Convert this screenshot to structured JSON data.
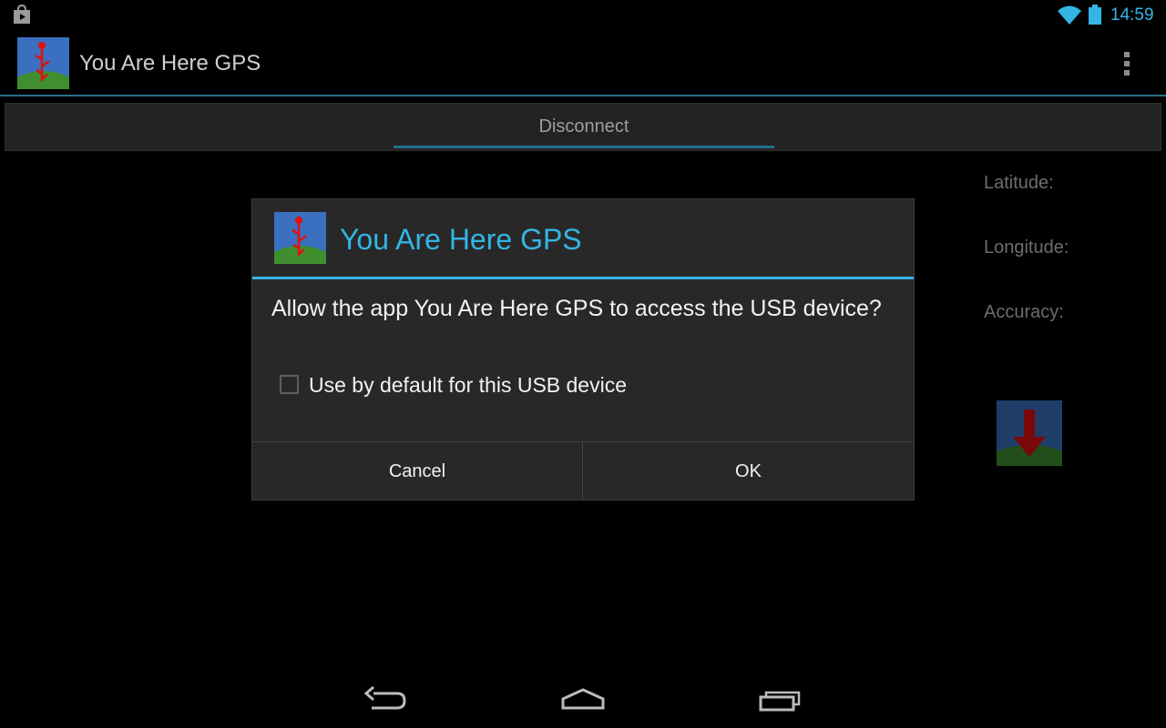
{
  "status_bar": {
    "time": "14:59",
    "icons": [
      "store-icon",
      "wifi-icon",
      "battery-icon"
    ],
    "accent_color": "#33b5e5"
  },
  "action_bar": {
    "title": "You Are Here GPS",
    "app_icon": "app-icon",
    "overflow_icon": "overflow-menu-icon"
  },
  "main": {
    "disconnect_label": "Disconnect",
    "latitude_label": "Latitude:",
    "longitude_label": "Longitude:",
    "accuracy_label": "Accuracy:",
    "download_icon": "download-arrow-icon"
  },
  "dialog": {
    "title": "You Are Here GPS",
    "message": "Allow the app You Are Here GPS to access the USB device?",
    "checkbox_label": "Use by default for this USB device",
    "checkbox_checked": false,
    "cancel_label": "Cancel",
    "ok_label": "OK"
  },
  "nav_bar": {
    "icons": [
      "back-icon",
      "home-icon",
      "recent-apps-icon"
    ]
  }
}
